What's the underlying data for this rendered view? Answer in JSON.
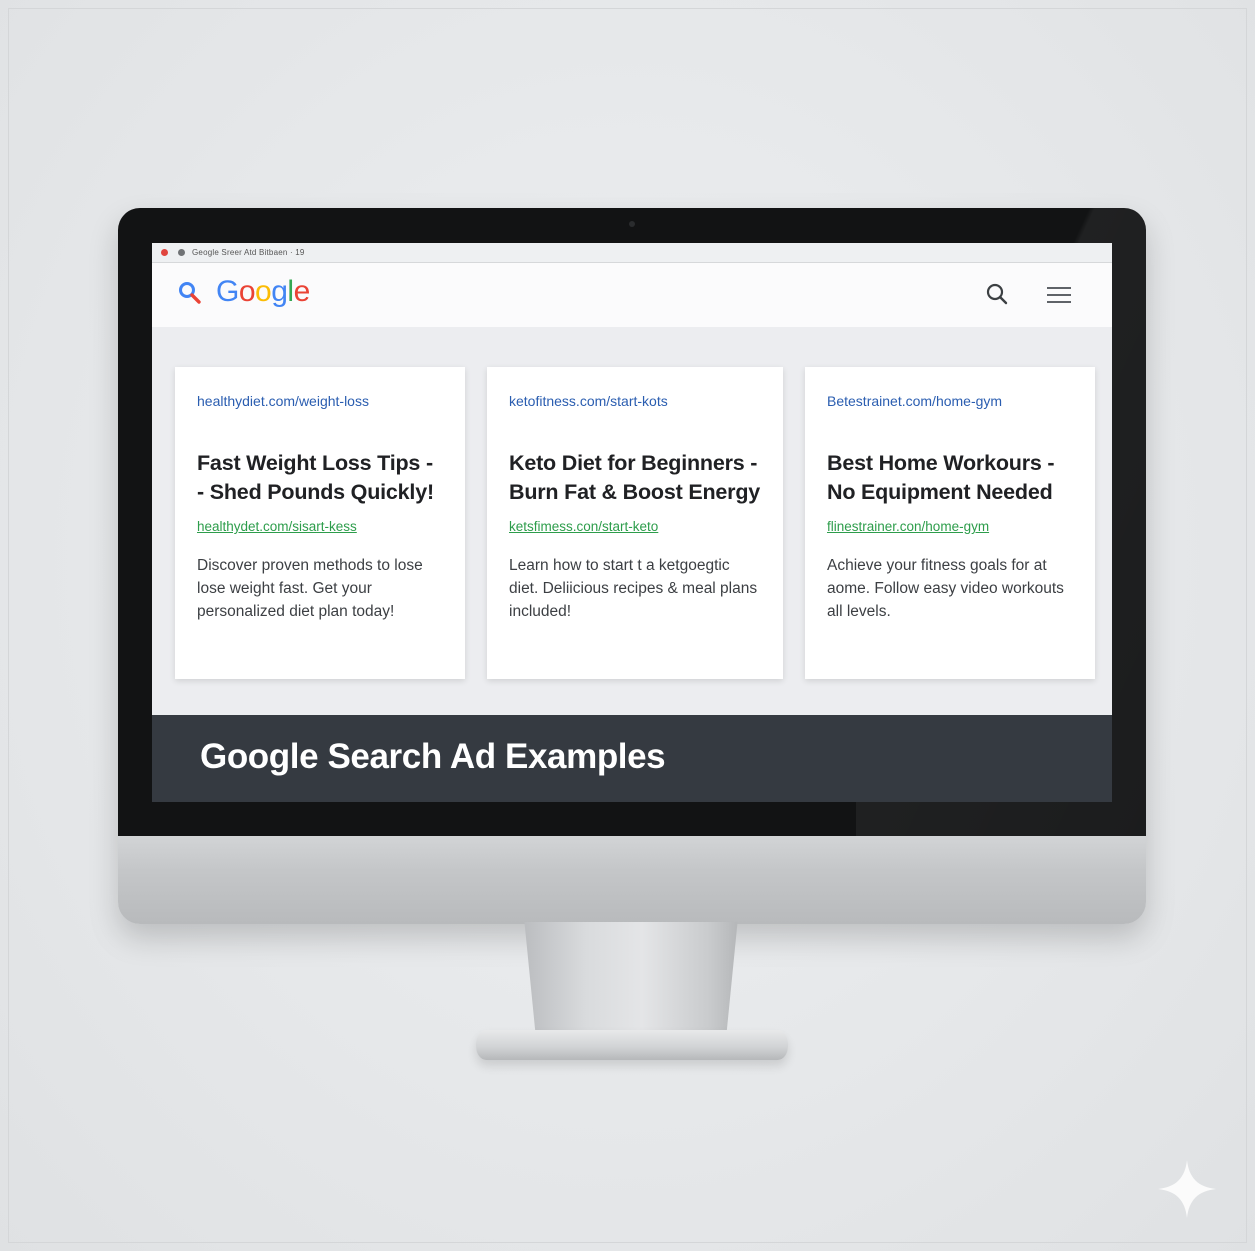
{
  "window": {
    "titlebar_text": "Geogle  Sreer Atd    Bitbaen · 19"
  },
  "appbar": {
    "logo": {
      "letters": [
        "G",
        "o",
        "o",
        "g",
        "l",
        "e"
      ]
    },
    "search_icon": "search-icon",
    "menu_icon": "hamburger-menu-icon"
  },
  "ads": [
    {
      "display_url": "healthydiet.com/weight-loss",
      "headline": "Fast Weight Loss Tips - - Shed Pounds Quickly!",
      "link_url": "healthydet.com/sisart-kess",
      "description": "Discover proven methods to lose lose weight fast. Get your personalized diet plan today!"
    },
    {
      "display_url": "ketofitness.com/start-kots",
      "headline": "Keto Diet for Beginners - Burn Fat & Boost Energy",
      "link_url": "ketsfimess.con/start-keto",
      "description": "Learn how to start t a ketgoegtic diet. Deliicious recipes & meal plans included!"
    },
    {
      "display_url": "Betestrainet.com/home-gym",
      "headline": "Best Home Workours - No Equipment Needed",
      "link_url": "flinestrainer.con/home-gym",
      "description": "Achieve your fitness goals for at aome. Follow easy video workouts all levels."
    }
  ],
  "banner": {
    "title": "Google Search Ad Examples"
  },
  "colors": {
    "url_blue": "#2a5db0",
    "link_green": "#2d9d4b",
    "banner_bg": "#353a41",
    "google_blue": "#4285f4",
    "google_red": "#ea4335",
    "google_yellow": "#fbbc05",
    "google_green": "#34a853"
  }
}
